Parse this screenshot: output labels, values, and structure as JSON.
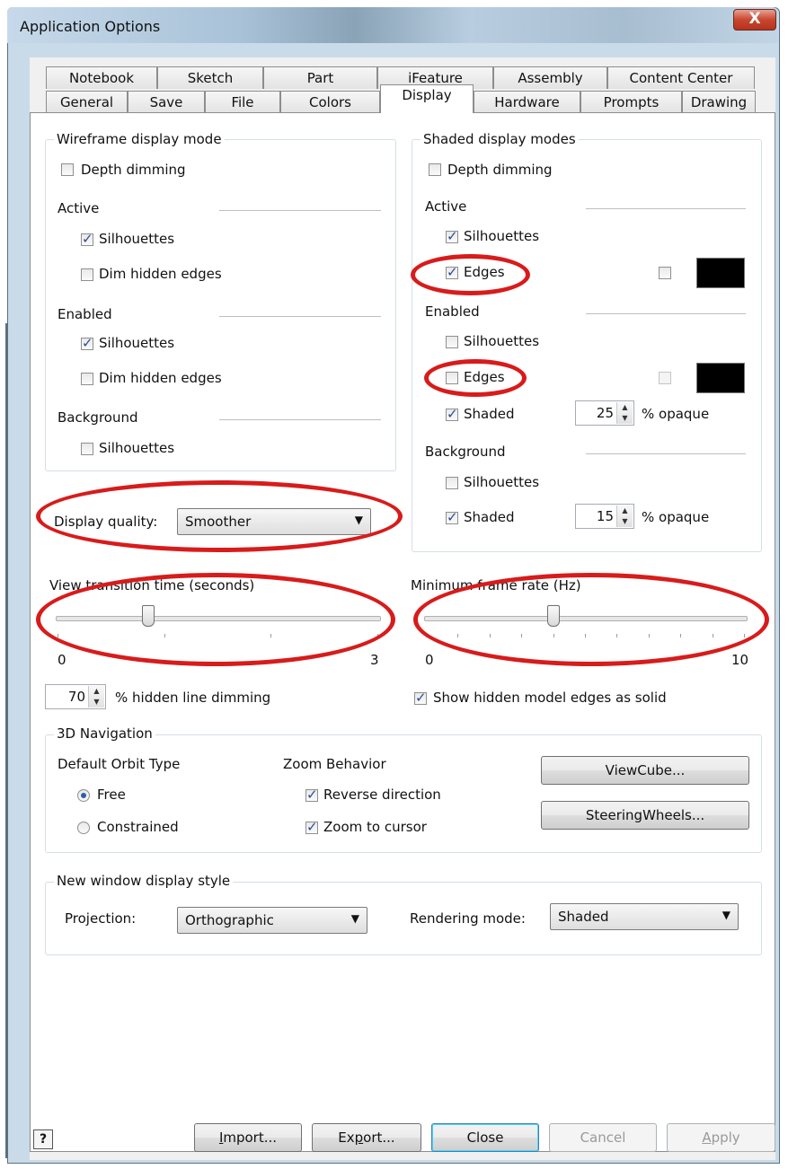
{
  "window": {
    "title": "Application Options",
    "close_glyph": "X"
  },
  "tabs": {
    "row1": [
      "Notebook",
      "Sketch",
      "Part",
      "iFeature",
      "Assembly",
      "Content Center"
    ],
    "row2": [
      "General",
      "Save",
      "File",
      "Colors",
      "Display",
      "Hardware",
      "Prompts",
      "Drawing"
    ],
    "active": "Display"
  },
  "wireframe": {
    "title": "Wireframe display mode",
    "depth_dimming": "Depth dimming",
    "active": "Active",
    "active_silhouettes": "Silhouettes",
    "active_dim_hidden": "Dim hidden edges",
    "enabled": "Enabled",
    "enabled_silhouettes": "Silhouettes",
    "enabled_dim_hidden": "Dim hidden edges",
    "background": "Background",
    "background_silhouettes": "Silhouettes"
  },
  "shaded": {
    "title": "Shaded display modes",
    "depth_dimming": "Depth dimming",
    "active": "Active",
    "active_silhouettes": "Silhouettes",
    "active_edges": "Edges",
    "enabled": "Enabled",
    "enabled_silhouettes": "Silhouettes",
    "enabled_edges": "Edges",
    "enabled_shaded": "Shaded",
    "enabled_opacity": "25",
    "opaque_label": "% opaque",
    "background": "Background",
    "background_silhouettes": "Silhouettes",
    "background_shaded": "Shaded",
    "background_opacity": "15",
    "edge_color": "#000000"
  },
  "display_quality": {
    "label": "Display quality:",
    "value": "Smoother"
  },
  "view_transition": {
    "label": "View transition time (seconds)",
    "min": "0",
    "max": "3",
    "value": 0.85
  },
  "min_frame_rate": {
    "label": "Minimum frame rate (Hz)",
    "min": "0",
    "max": "10",
    "value": 4
  },
  "hidden_line": {
    "value": "70",
    "label": "% hidden line dimming"
  },
  "show_hidden_solid": "Show hidden model edges as solid",
  "nav3d": {
    "title": "3D Navigation",
    "orbit_title": "Default Orbit Type",
    "free": "Free",
    "constrained": "Constrained",
    "zoom_title": "Zoom Behavior",
    "reverse": "Reverse direction",
    "zoom_cursor": "Zoom to cursor",
    "viewcube": "ViewCube...",
    "steeringwheels": "SteeringWheels..."
  },
  "new_window": {
    "title": "New window display style",
    "projection_label": "Projection:",
    "projection_value": "Orthographic",
    "rendering_label": "Rendering mode:",
    "rendering_value": "Shaded"
  },
  "footer": {
    "help": "?",
    "import_u": "I",
    "import_rest": "mport...",
    "export_a": "Ex",
    "export_u": "p",
    "export_b": "ort...",
    "close": "Close",
    "cancel": "Cancel",
    "apply_u": "A",
    "apply_rest": "pply"
  },
  "colors": {
    "annotation": "#d81b1b",
    "window_frame": "#c9dbe9"
  }
}
